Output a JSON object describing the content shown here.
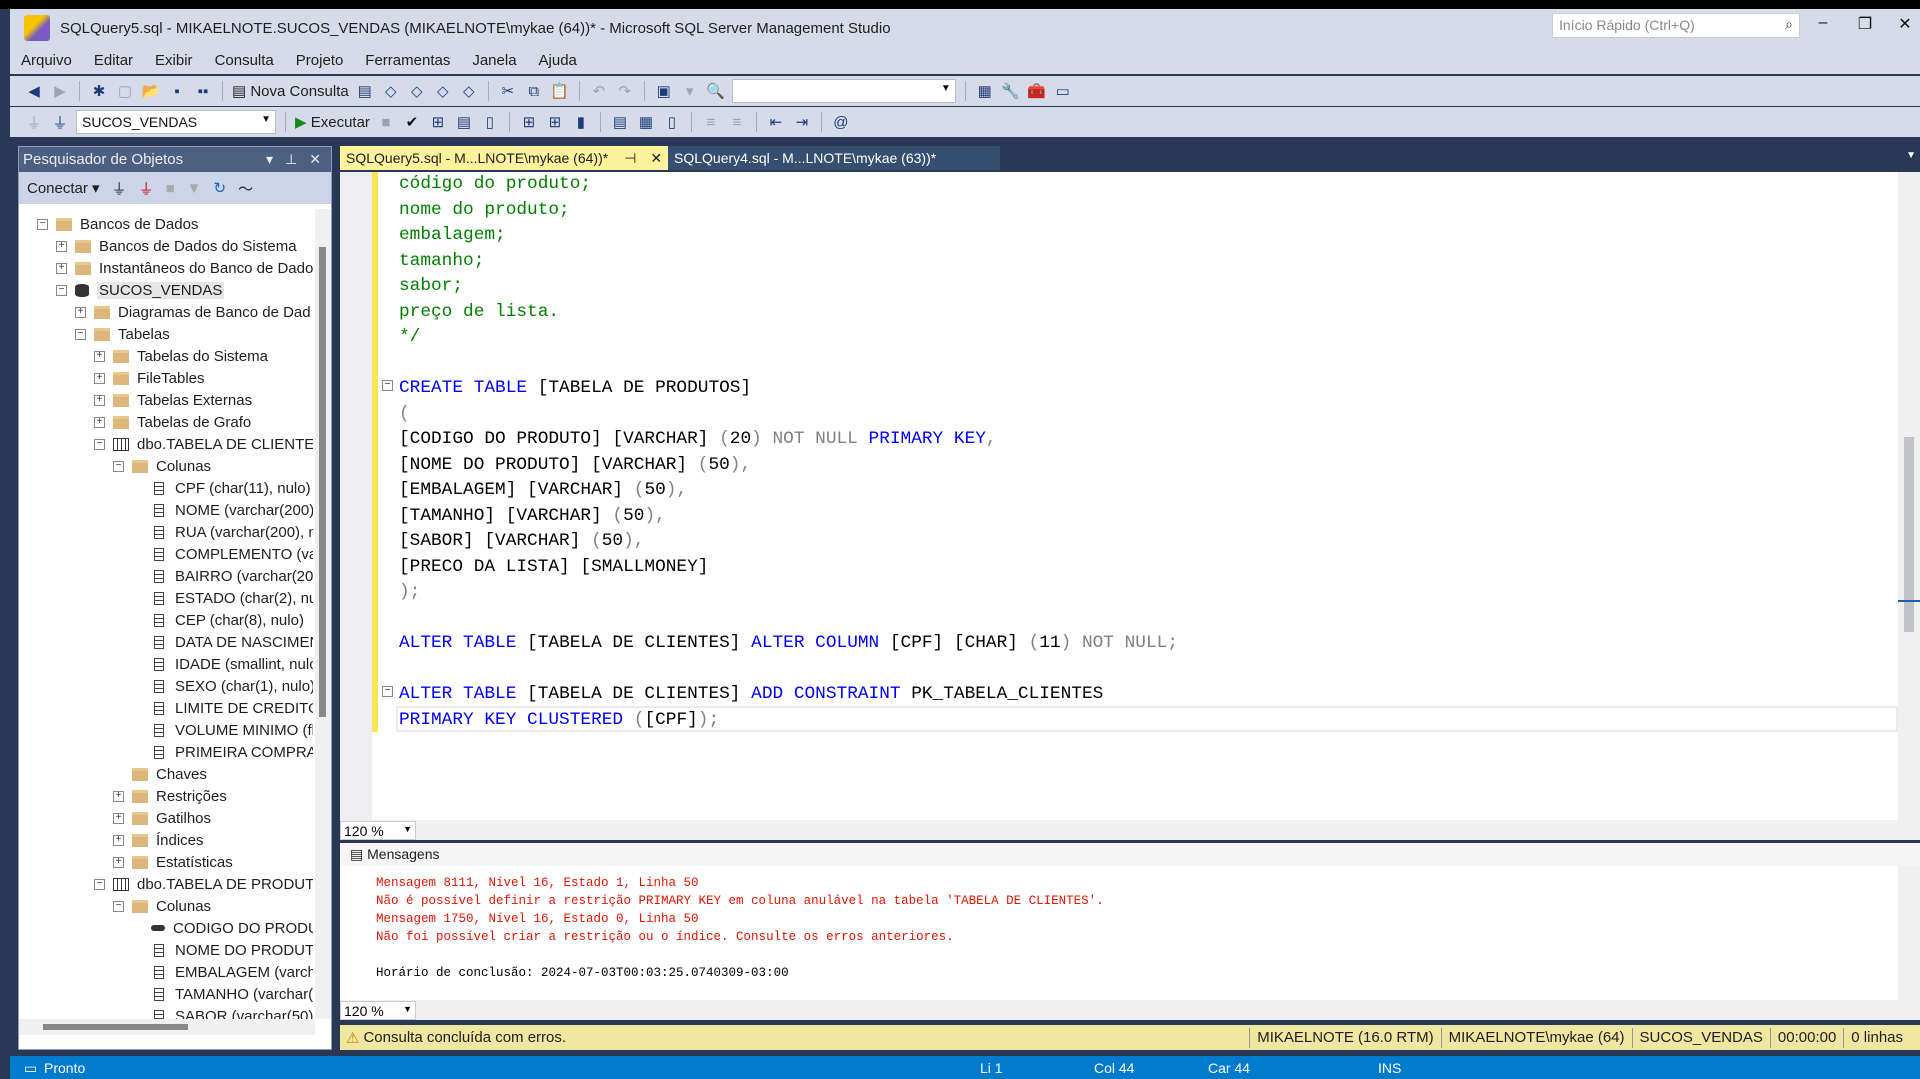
{
  "window": {
    "title": "SQLQuery5.sql - MIKAELNOTE.SUCOS_VENDAS (MIKAELNOTE\\mykae (64))* - Microsoft SQL Server Management Studio",
    "quick_launch_placeholder": "Início Rápido (Ctrl+Q)"
  },
  "menu": [
    "Arquivo",
    "Editar",
    "Exibir",
    "Consulta",
    "Projeto",
    "Ferramentas",
    "Janela",
    "Ajuda"
  ],
  "toolbar": {
    "new_query": "Nova Consulta",
    "execute": "Executar",
    "database": "SUCOS_VENDAS",
    "solution_config": ""
  },
  "object_explorer": {
    "title": "Pesquisador de Objetos",
    "connect": "Conectar",
    "tree": [
      {
        "level": 0,
        "exp": "-",
        "icon": "folder",
        "label": "Bancos de Dados"
      },
      {
        "level": 1,
        "exp": "+",
        "icon": "folder",
        "label": "Bancos de Dados do Sistema"
      },
      {
        "level": 1,
        "exp": "+",
        "icon": "folder",
        "label": "Instantâneos do Banco de Dado"
      },
      {
        "level": 1,
        "exp": "-",
        "icon": "db",
        "label": "SUCOS_VENDAS",
        "selected": true
      },
      {
        "level": 2,
        "exp": "+",
        "icon": "folder",
        "label": "Diagramas de Banco de Dad"
      },
      {
        "level": 2,
        "exp": "-",
        "icon": "folder",
        "label": "Tabelas"
      },
      {
        "level": 3,
        "exp": "+",
        "icon": "folder",
        "label": "Tabelas do Sistema"
      },
      {
        "level": 3,
        "exp": "+",
        "icon": "folder",
        "label": "FileTables"
      },
      {
        "level": 3,
        "exp": "+",
        "icon": "folder",
        "label": "Tabelas Externas"
      },
      {
        "level": 3,
        "exp": "+",
        "icon": "folder",
        "label": "Tabelas de Grafo"
      },
      {
        "level": 3,
        "exp": "-",
        "icon": "table",
        "label": "dbo.TABELA DE CLIENTES"
      },
      {
        "level": 4,
        "exp": "-",
        "icon": "folder",
        "label": "Colunas"
      },
      {
        "level": 5,
        "exp": "",
        "icon": "col",
        "label": "CPF (char(11), nulo)"
      },
      {
        "level": 5,
        "exp": "",
        "icon": "col",
        "label": "NOME (varchar(200),"
      },
      {
        "level": 5,
        "exp": "",
        "icon": "col",
        "label": "RUA (varchar(200), n"
      },
      {
        "level": 5,
        "exp": "",
        "icon": "col",
        "label": "COMPLEMENTO (var"
      },
      {
        "level": 5,
        "exp": "",
        "icon": "col",
        "label": "BAIRRO (varchar(200"
      },
      {
        "level": 5,
        "exp": "",
        "icon": "col",
        "label": "ESTADO (char(2), nul"
      },
      {
        "level": 5,
        "exp": "",
        "icon": "col",
        "label": "CEP (char(8), nulo)"
      },
      {
        "level": 5,
        "exp": "",
        "icon": "col",
        "label": "DATA DE NASCIMEN"
      },
      {
        "level": 5,
        "exp": "",
        "icon": "col",
        "label": "IDADE (smallint, nulo"
      },
      {
        "level": 5,
        "exp": "",
        "icon": "col",
        "label": "SEXO (char(1), nulo)"
      },
      {
        "level": 5,
        "exp": "",
        "icon": "col",
        "label": "LIMITE DE CREDITO"
      },
      {
        "level": 5,
        "exp": "",
        "icon": "col",
        "label": "VOLUME MINIMO (fl"
      },
      {
        "level": 5,
        "exp": "",
        "icon": "col",
        "label": "PRIMEIRA COMPRA ("
      },
      {
        "level": 4,
        "exp": "",
        "icon": "folder",
        "label": "Chaves"
      },
      {
        "level": 4,
        "exp": "+",
        "icon": "folder",
        "label": "Restrições"
      },
      {
        "level": 4,
        "exp": "+",
        "icon": "folder",
        "label": "Gatilhos"
      },
      {
        "level": 4,
        "exp": "+",
        "icon": "folder",
        "label": "Índices"
      },
      {
        "level": 4,
        "exp": "+",
        "icon": "folder",
        "label": "Estatísticas"
      },
      {
        "level": 3,
        "exp": "-",
        "icon": "table",
        "label": "dbo.TABELA DE PRODUTO"
      },
      {
        "level": 4,
        "exp": "-",
        "icon": "folder",
        "label": "Colunas"
      },
      {
        "level": 5,
        "exp": "",
        "icon": "key",
        "label": "CODIGO DO PRODU"
      },
      {
        "level": 5,
        "exp": "",
        "icon": "col",
        "label": "NOME DO PRODUTO"
      },
      {
        "level": 5,
        "exp": "",
        "icon": "col",
        "label": "EMBALAGEM (varcha"
      },
      {
        "level": 5,
        "exp": "",
        "icon": "col",
        "label": "TAMANHO (varchar("
      },
      {
        "level": 5,
        "exp": "",
        "icon": "col",
        "label": "SABOR (varchar(50),"
      }
    ]
  },
  "tabs": [
    {
      "label": "SQLQuery5.sql - M...LNOTE\\mykae (64))*",
      "active": true
    },
    {
      "label": "SQLQuery4.sql - M...LNOTE\\mykae (63))*"
    }
  ],
  "code": [
    [
      [
        "código do produto;",
        "c"
      ]
    ],
    [
      [
        "nome do produto;",
        "c"
      ]
    ],
    [
      [
        "embalagem;",
        "c"
      ]
    ],
    [
      [
        "tamanho;",
        "c"
      ]
    ],
    [
      [
        "sabor;",
        "c"
      ]
    ],
    [
      [
        "preço de lista.",
        "c"
      ]
    ],
    [
      [
        "*/",
        "c"
      ]
    ],
    [],
    [
      [
        "CREATE TABLE",
        "k"
      ],
      [
        " [TABELA DE PRODUTOS]",
        "t"
      ]
    ],
    [
      [
        "(",
        "g"
      ]
    ],
    [
      [
        "[CODIGO DO PRODUTO] [VARCHAR] ",
        "t"
      ],
      [
        "(",
        "g"
      ],
      [
        "20",
        "t"
      ],
      [
        ") NOT NULL ",
        "g"
      ],
      [
        "PRIMARY KEY",
        "k"
      ],
      [
        ",",
        "g"
      ]
    ],
    [
      [
        "[NOME DO PRODUTO] [VARCHAR] ",
        "t"
      ],
      [
        "(",
        "g"
      ],
      [
        "50",
        "t"
      ],
      [
        "),",
        "g"
      ]
    ],
    [
      [
        "[EMBALAGEM] [VARCHAR] ",
        "t"
      ],
      [
        "(",
        "g"
      ],
      [
        "50",
        "t"
      ],
      [
        "),",
        "g"
      ]
    ],
    [
      [
        "[TAMANHO] [VARCHAR] ",
        "t"
      ],
      [
        "(",
        "g"
      ],
      [
        "50",
        "t"
      ],
      [
        "),",
        "g"
      ]
    ],
    [
      [
        "[SABOR] [VARCHAR] ",
        "t"
      ],
      [
        "(",
        "g"
      ],
      [
        "50",
        "t"
      ],
      [
        "),",
        "g"
      ]
    ],
    [
      [
        "[PRECO DA LISTA] [SMALLMONEY]",
        "t"
      ]
    ],
    [
      [
        ");",
        "g"
      ]
    ],
    [],
    [
      [
        "ALTER TABLE",
        "k"
      ],
      [
        " [TABELA DE CLIENTES] ",
        "t"
      ],
      [
        "ALTER COLUMN",
        "k"
      ],
      [
        " [CPF] [CHAR] ",
        "t"
      ],
      [
        "(",
        "g"
      ],
      [
        "11",
        "t"
      ],
      [
        ") NOT NULL;",
        "g"
      ]
    ],
    [],
    [
      [
        "ALTER TABLE",
        "k"
      ],
      [
        " [TABELA DE CLIENTES] ",
        "t"
      ],
      [
        "ADD CONSTRAINT",
        "k"
      ],
      [
        " PK_TABELA_CLIENTES",
        "t"
      ]
    ],
    [
      [
        "PRIMARY KEY CLUSTERED",
        "k"
      ],
      [
        " (",
        "g"
      ],
      [
        "[CPF]",
        "t"
      ],
      [
        ");",
        "g"
      ]
    ]
  ],
  "editor_zoom": "120 %",
  "messages": {
    "tab": "Mensagens",
    "lines": [
      {
        "text": "Mensagem 8111, Nível 16, Estado 1, Linha 50",
        "err": true
      },
      {
        "text": "Não é possível definir a restrição PRIMARY KEY em coluna anulável na tabela 'TABELA DE CLIENTES'.",
        "err": true
      },
      {
        "text": "Mensagem 1750, Nível 16, Estado 0, Linha 50",
        "err": true
      },
      {
        "text": "Não foi possível criar a restrição ou o índice. Consulte os erros anteriores.",
        "err": true
      },
      {
        "text": "",
        "err": false
      },
      {
        "text": "Horário de conclusão: 2024-07-03T00:03:25.0740309-03:00",
        "err": false
      }
    ],
    "zoom": "120 %"
  },
  "query_status": {
    "text": "Consulta concluída com erros.",
    "server": "MIKAELNOTE (16.0 RTM)",
    "user": "MIKAELNOTE\\mykae (64)",
    "database": "SUCOS_VENDAS",
    "time": "00:00:00",
    "rows": "0 linhas"
  },
  "status": {
    "ready": "Pronto",
    "line": "Li 1",
    "col": "Col 44",
    "char": "Car 44",
    "mode": "INS"
  },
  "colors": {
    "keyword": "#0000ff",
    "comment": "#008000",
    "operator": "#808080",
    "error": "#e51400",
    "statusbar": "#007acc",
    "query_status": "#efe7a0",
    "active_tab": "#fff29d"
  }
}
